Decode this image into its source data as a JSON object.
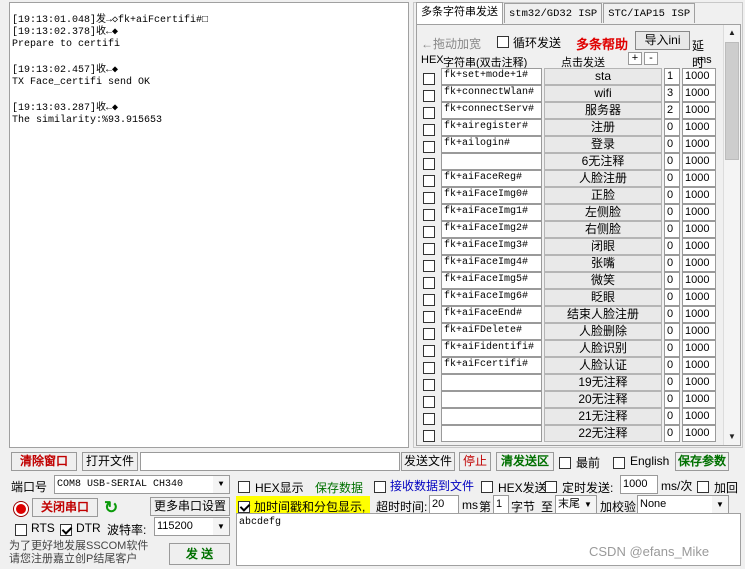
{
  "receive_log": [
    {
      "ts": "[19:13:01.048]发→◇fk+aiFcertifi#□",
      "msg": ""
    },
    {
      "ts": "[19:13:02.378]收←◆",
      "msg": "Prepare to certifi"
    },
    {
      "ts": "[19:13:02.457]收←◆",
      "msg": "TX Face_certifi send OK"
    },
    {
      "ts": "[19:13:03.287]收←◆",
      "msg": "The similarity:%93.915653"
    }
  ],
  "tabs": [
    {
      "label": "多条字符串发送"
    },
    {
      "label": "stm32/GD32 ISP"
    },
    {
      "label": "STC/IAP15 ISP"
    }
  ],
  "multi": {
    "drag_label": "←拖动加宽",
    "loop_label": "循环发送",
    "help_label": "多条帮助",
    "import_label": "导入ini",
    "delay_label": "延时",
    "col_hex": "HEX",
    "col_string": "字符串(双击注释)",
    "col_click": "点击发送",
    "col_ms": "ms",
    "plus": "+",
    "minus": "-"
  },
  "rows": [
    {
      "cmd": "fk+set+mode+1#",
      "btn": "sta",
      "num": "1",
      "ms": "1000"
    },
    {
      "cmd": "fk+connectWlan#",
      "btn": "wifi",
      "num": "3",
      "ms": "1000"
    },
    {
      "cmd": "fk+connectServ#",
      "btn": "服务器",
      "num": "2",
      "ms": "1000"
    },
    {
      "cmd": "fk+airegister#",
      "btn": "注册",
      "num": "0",
      "ms": "1000"
    },
    {
      "cmd": "fk+ailogin#",
      "btn": "登录",
      "num": "0",
      "ms": "1000"
    },
    {
      "cmd": "",
      "btn": "6无注释",
      "num": "0",
      "ms": "1000"
    },
    {
      "cmd": "fk+aiFaceReg#",
      "btn": "人脸注册",
      "num": "0",
      "ms": "1000"
    },
    {
      "cmd": "fk+aiFaceImg0#",
      "btn": "正脸",
      "num": "0",
      "ms": "1000"
    },
    {
      "cmd": "fk+aiFaceImg1#",
      "btn": "左侧脸",
      "num": "0",
      "ms": "1000"
    },
    {
      "cmd": "fk+aiFaceImg2#",
      "btn": "右侧脸",
      "num": "0",
      "ms": "1000"
    },
    {
      "cmd": "fk+aiFaceImg3#",
      "btn": "闭眼",
      "num": "0",
      "ms": "1000"
    },
    {
      "cmd": "fk+aiFaceImg4#",
      "btn": "张嘴",
      "num": "0",
      "ms": "1000"
    },
    {
      "cmd": "fk+aiFaceImg5#",
      "btn": "微笑",
      "num": "0",
      "ms": "1000"
    },
    {
      "cmd": "fk+aiFaceImg6#",
      "btn": "眨眼",
      "num": "0",
      "ms": "1000"
    },
    {
      "cmd": "fk+aiFaceEnd#",
      "btn": "结束人脸注册",
      "num": "0",
      "ms": "1000"
    },
    {
      "cmd": "fk+aiFDelete#",
      "btn": "人脸删除",
      "num": "0",
      "ms": "1000"
    },
    {
      "cmd": "fk+aiFidentifi#",
      "btn": "人脸识别",
      "num": "0",
      "ms": "1000"
    },
    {
      "cmd": "fk+aiFcertifi#",
      "btn": "人脸认证",
      "num": "0",
      "ms": "1000"
    },
    {
      "cmd": "",
      "btn": "19无注释",
      "num": "0",
      "ms": "1000"
    },
    {
      "cmd": "",
      "btn": "20无注释",
      "num": "0",
      "ms": "1000"
    },
    {
      "cmd": "",
      "btn": "21无注释",
      "num": "0",
      "ms": "1000"
    },
    {
      "cmd": "",
      "btn": "22无注释",
      "num": "0",
      "ms": "1000"
    }
  ],
  "toolbar": {
    "clear": "清除窗口",
    "open_file": "打开文件",
    "send_file": "发送文件",
    "stop": "停止",
    "clear_send": "清发送区",
    "top": "最前",
    "english": "English",
    "save_params": "保存参数"
  },
  "port": {
    "label": "端口号",
    "value": "COM8 USB-SERIAL CH340",
    "close_btn": "关闭串口",
    "more_settings": "更多串口设置",
    "rts": "RTS",
    "dtr": "DTR",
    "baud_label": "波特率:",
    "baud_value": "115200"
  },
  "options": {
    "hex_show": "HEX显示",
    "save_data": "保存数据",
    "recv_to_file": "接收数据到文件",
    "hex_send": "HEX发送",
    "timed_send": "定时发送:",
    "interval": "1000",
    "interval_unit": "ms/次",
    "add_ret": "加回",
    "timestamp": "加时间戳和分包显示,",
    "timeout_label": "超时时间:",
    "timeout_value": "20",
    "ms": "ms",
    "byte_prefix": "第",
    "byte_value": "1",
    "byte_unit": "字节",
    "to": "至",
    "end_value": "末尾",
    "checksum_label": "加校验",
    "checksum_value": "None"
  },
  "send_text": "abcdefg",
  "send_btn": "发 送",
  "hint": [
    "为了更好地发展SSCOM软件",
    "请您注册嘉立创P结尾客户"
  ],
  "watermark": "CSDN @efans_Mike"
}
